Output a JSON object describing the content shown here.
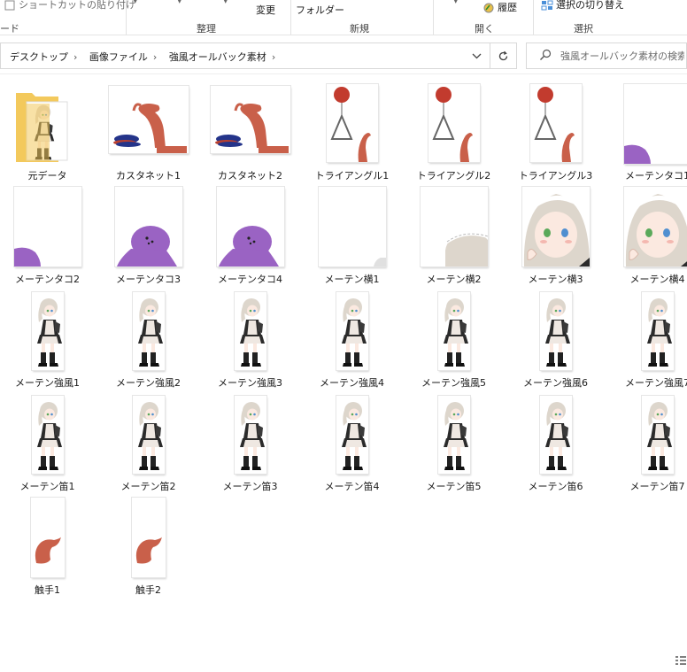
{
  "ribbon": {
    "shortcut_paste": "ショートカットの貼り付け",
    "clipboard_group_partial": "ード",
    "rename_partial": "変更",
    "new_folder_partial": "フォルダー",
    "history": "履歴",
    "invert_selection": "選択の切り替え",
    "groups": {
      "organize": "整理",
      "new": "新規",
      "open": "開く",
      "select": "選択"
    }
  },
  "address": {
    "crumbs": [
      "デスクトップ",
      "画像ファイル",
      "強風オールバック素材"
    ],
    "dropdown_icon": "chevron-down-icon",
    "refresh_icon": "refresh-icon"
  },
  "search": {
    "placeholder": "強風オールバック素材の検索",
    "value": ""
  },
  "colors": {
    "folder": "#f3c95c",
    "tentacle": "#c9604a",
    "balloon": "#c23b2e",
    "octopus": "#9a63c3",
    "castanet": "#24348a",
    "hair": "#ddd6cc",
    "dress": "#2b2b2b",
    "apron": "#efe8e2"
  },
  "files": [
    {
      "name": "元データ",
      "kind": "folder"
    },
    {
      "name": "カスタネット1",
      "kind": "castanet"
    },
    {
      "name": "カスタネット2",
      "kind": "castanet"
    },
    {
      "name": "トライアングル1",
      "kind": "triangle"
    },
    {
      "name": "トライアングル2",
      "kind": "triangle"
    },
    {
      "name": "トライアングル3",
      "kind": "triangle"
    },
    {
      "name": "メーテンタコ1",
      "kind": "octopus-corner"
    },
    {
      "name": "メーテンタコ2",
      "kind": "octopus-corner"
    },
    {
      "name": "メーテンタコ3",
      "kind": "octopus"
    },
    {
      "name": "メーテンタコ4",
      "kind": "octopus"
    },
    {
      "name": "メーテン横1",
      "kind": "side-empty"
    },
    {
      "name": "メーテン横2",
      "kind": "side-peek"
    },
    {
      "name": "メーテン横3",
      "kind": "side-face"
    },
    {
      "name": "メーテン横4",
      "kind": "side-face"
    },
    {
      "name": "メーテン強風1",
      "kind": "maid"
    },
    {
      "name": "メーテン強風2",
      "kind": "maid"
    },
    {
      "name": "メーテン強風3",
      "kind": "maid"
    },
    {
      "name": "メーテン強風4",
      "kind": "maid"
    },
    {
      "name": "メーテン強風5",
      "kind": "maid"
    },
    {
      "name": "メーテン強風6",
      "kind": "maid"
    },
    {
      "name": "メーテン強風7",
      "kind": "maid"
    },
    {
      "name": "メーテン笛1",
      "kind": "maid"
    },
    {
      "name": "メーテン笛2",
      "kind": "maid"
    },
    {
      "name": "メーテン笛3",
      "kind": "maid"
    },
    {
      "name": "メーテン笛4",
      "kind": "maid"
    },
    {
      "name": "メーテン笛5",
      "kind": "maid"
    },
    {
      "name": "メーテン笛6",
      "kind": "maid"
    },
    {
      "name": "メーテン笛7",
      "kind": "maid"
    },
    {
      "name": "触手1",
      "kind": "tentacle"
    },
    {
      "name": "触手2",
      "kind": "tentacle"
    }
  ],
  "status": {
    "view_icon": "details-view-icon"
  }
}
